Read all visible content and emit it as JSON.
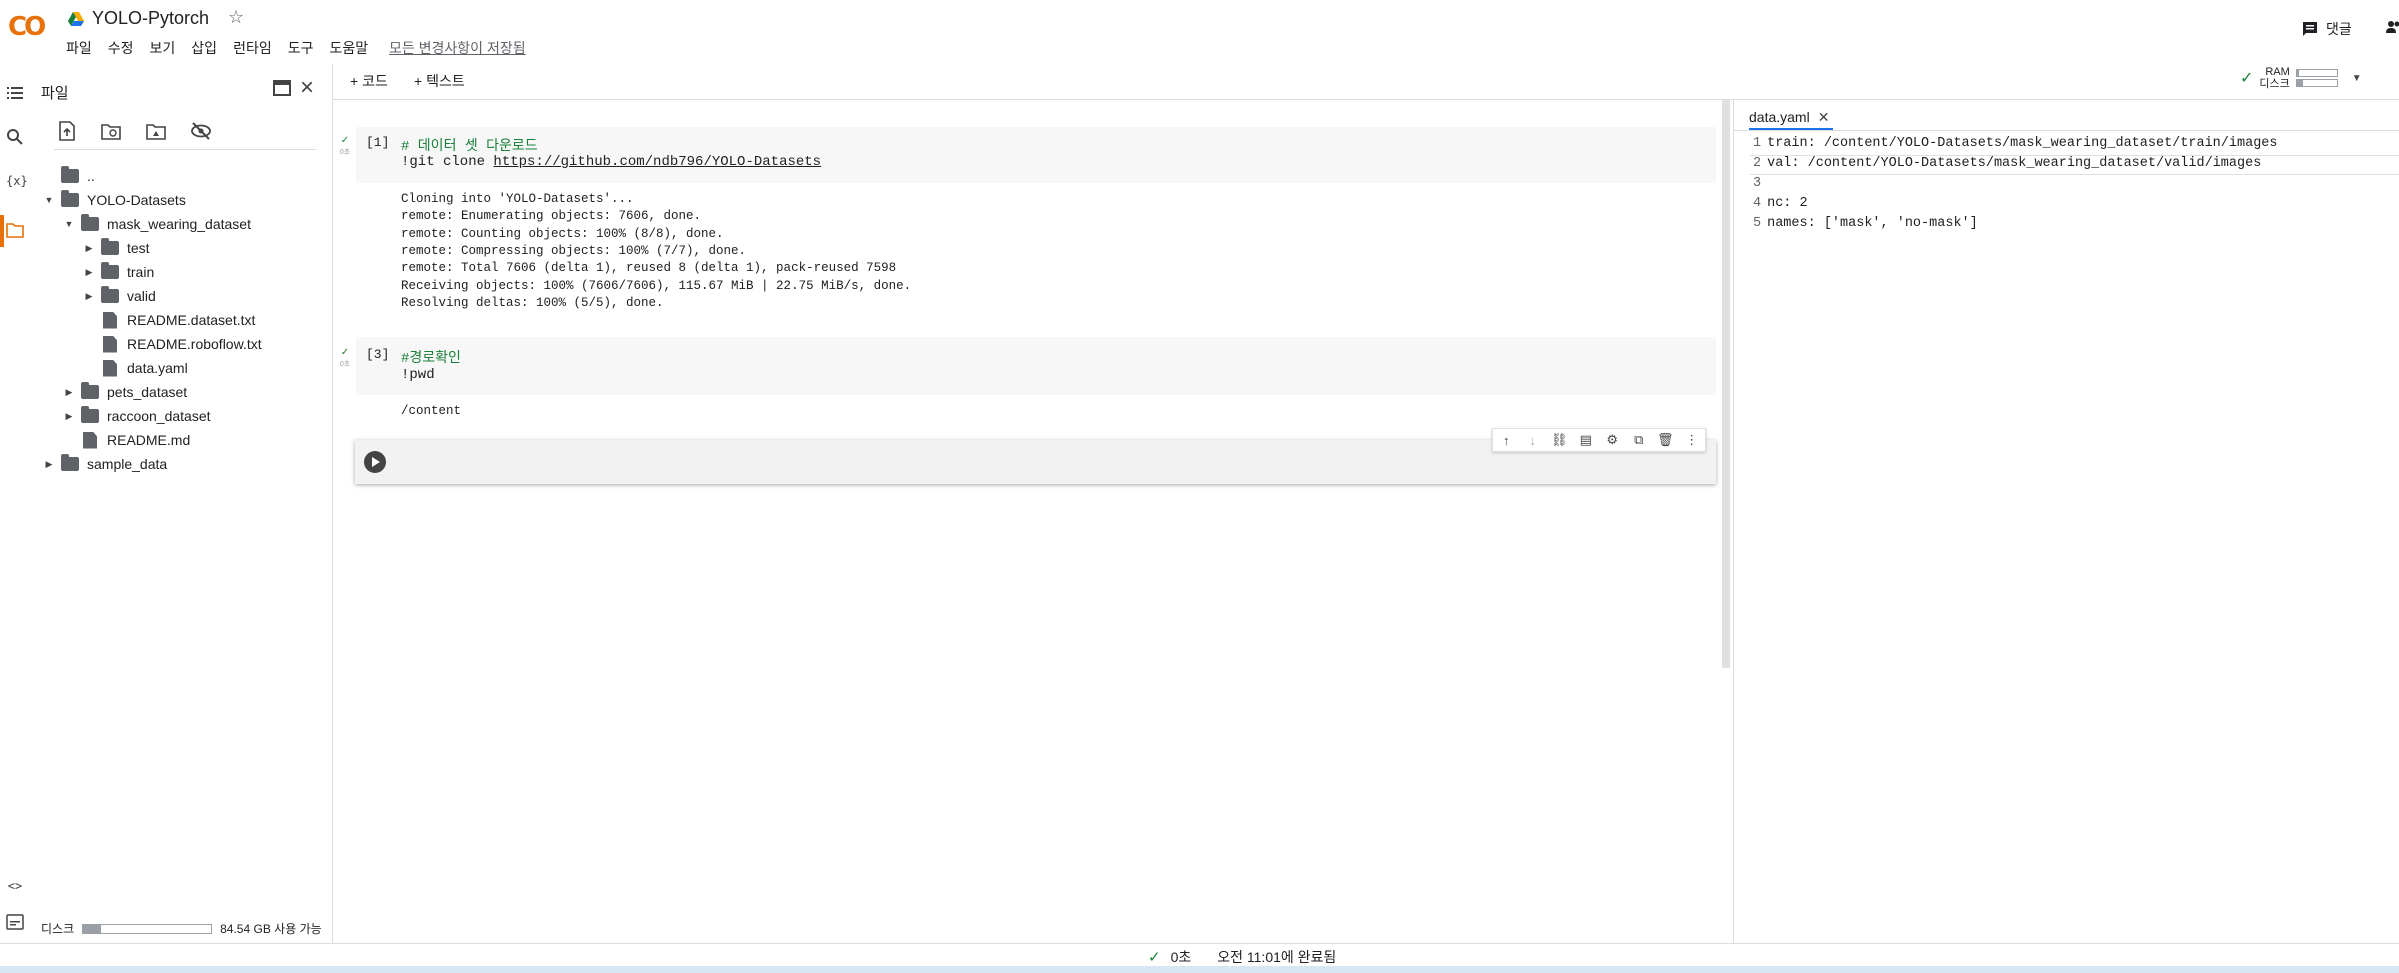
{
  "app": {
    "logo_text": "CO",
    "title": "YOLO-Pytorch",
    "save_status": "모든 변경사항이 저장됨",
    "comment_label": "댓글"
  },
  "menu": [
    "파일",
    "수정",
    "보기",
    "삽입",
    "런타임",
    "도구",
    "도움말"
  ],
  "sidebar": {
    "title": "파일",
    "disk_label": "디스크",
    "disk_free": "84.54 GB 사용 가능",
    "disk_used_fraction": 0.14,
    "tree": [
      {
        "label": "..",
        "type": "up",
        "depth": 1
      },
      {
        "label": "YOLO-Datasets",
        "type": "folder",
        "depth": 1,
        "expanded": true
      },
      {
        "label": "mask_wearing_dataset",
        "type": "folder",
        "depth": 2,
        "expanded": true
      },
      {
        "label": "test",
        "type": "folder",
        "depth": 3,
        "expanded": false
      },
      {
        "label": "train",
        "type": "folder",
        "depth": 3,
        "expanded": false
      },
      {
        "label": "valid",
        "type": "folder",
        "depth": 3,
        "expanded": false
      },
      {
        "label": "README.dataset.txt",
        "type": "file",
        "depth": 3
      },
      {
        "label": "README.roboflow.txt",
        "type": "file",
        "depth": 3
      },
      {
        "label": "data.yaml",
        "type": "file",
        "depth": 3
      },
      {
        "label": "pets_dataset",
        "type": "folder",
        "depth": 2,
        "expanded": false
      },
      {
        "label": "raccoon_dataset",
        "type": "folder",
        "depth": 2,
        "expanded": false
      },
      {
        "label": "README.md",
        "type": "file",
        "depth": 2
      },
      {
        "label": "sample_data",
        "type": "folder",
        "depth": 0,
        "expanded": false
      }
    ]
  },
  "toolbar": {
    "add_code": "+ 코드",
    "add_text": "+ 텍스트",
    "ram_label": "RAM",
    "disk_label": "디스크",
    "ram_fraction": 0.05,
    "disk_fraction": 0.15
  },
  "cells": [
    {
      "exec_count": "[1]",
      "comment": "# 데이터 셋 다운로드",
      "code_prefix": "!git clone ",
      "code_url": "https://github.com/ndb796/YOLO-Datasets",
      "output": [
        "Cloning into 'YOLO-Datasets'...",
        "remote: Enumerating objects: 7606, done.",
        "remote: Counting objects: 100% (8/8), done.",
        "remote: Compressing objects: 100% (7/7), done.",
        "remote: Total 7606 (delta 1), reused 8 (delta 1), pack-reused 7598",
        "Receiving objects: 100% (7606/7606), 115.67 MiB | 22.75 MiB/s, done.",
        "Resolving deltas: 100% (5/5), done."
      ]
    },
    {
      "exec_count": "[3]",
      "comment": "#경로확인",
      "code": "!pwd",
      "output": [
        "/content"
      ]
    }
  ],
  "editor": {
    "tab": "data.yaml",
    "lines": [
      "train: /content/YOLO-Datasets/mask_wearing_dataset/train/images",
      "val: /content/YOLO-Datasets/mask_wearing_dataset/valid/images",
      "",
      "nc: 2",
      "names: ['mask', 'no-mask']"
    ]
  },
  "footer": {
    "duration": "0초",
    "completed": "오전 11:01에 완료됨"
  },
  "colors": {
    "logo_yellow": "#F9AB00",
    "logo_orange": "#E8710A",
    "success_green": "#188038",
    "accent_blue": "#1a73e8"
  }
}
